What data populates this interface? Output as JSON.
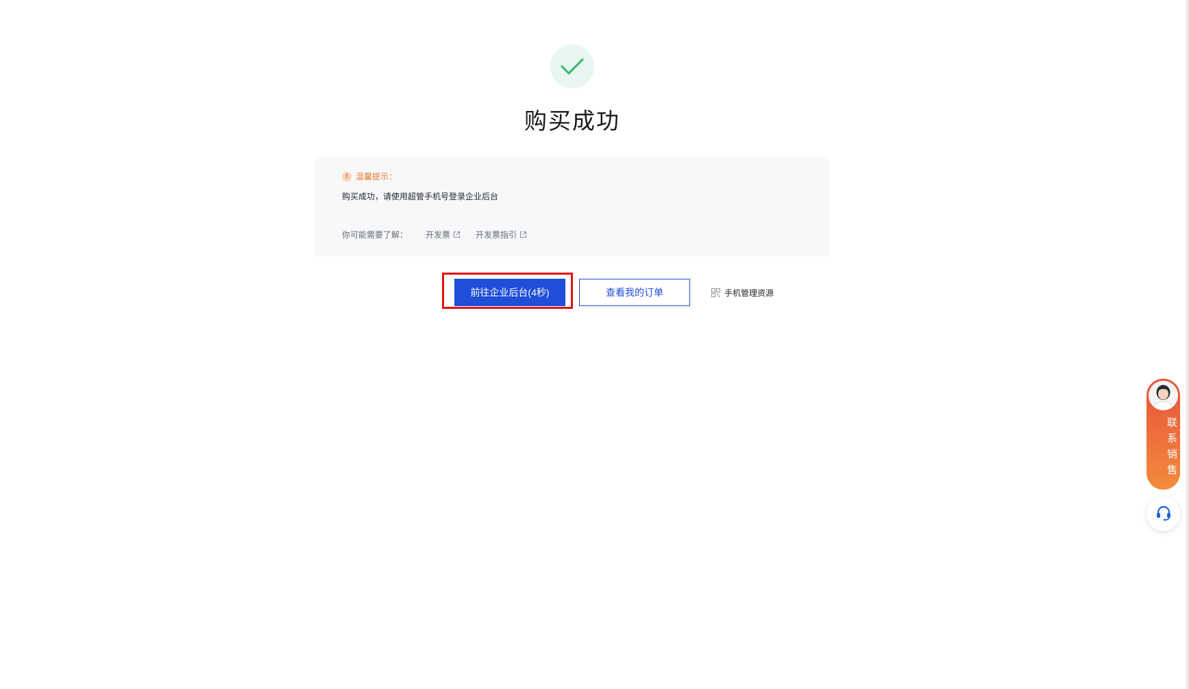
{
  "result": {
    "title": "购买成功",
    "icon": "check-icon",
    "icon_color": "#3fb979"
  },
  "tips": {
    "label": "温馨提示：",
    "message": "购买成功，请使用超管手机号登录企业后台",
    "links_prefix": "你可能需要了解：",
    "links": [
      {
        "label": "开发票",
        "icon": "external-link-icon"
      },
      {
        "label": "开发票指引",
        "icon": "external-link-icon"
      }
    ]
  },
  "actions": {
    "primary_label": "前往企业后台(4秒)",
    "secondary_label": "查看我的订单",
    "mobile_label": "手机管理资源",
    "mobile_icon": "qr-code-icon",
    "primary_color": "#1f4fd8",
    "highlight_color": "#e01010"
  },
  "floating": {
    "contact_sales_label": "联系销售",
    "support_icon": "headset-icon"
  }
}
